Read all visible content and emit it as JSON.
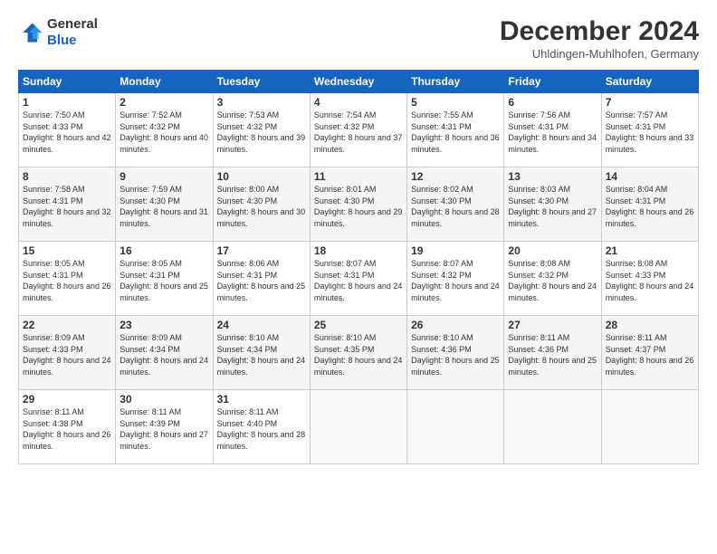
{
  "header": {
    "logo_line1": "General",
    "logo_line2": "Blue",
    "month": "December 2024",
    "location": "Uhldingen-Muhlhofen, Germany"
  },
  "days_of_week": [
    "Sunday",
    "Monday",
    "Tuesday",
    "Wednesday",
    "Thursday",
    "Friday",
    "Saturday"
  ],
  "weeks": [
    [
      {
        "day": "1",
        "rise": "7:50 AM",
        "set": "4:33 PM",
        "daylight": "8 hours and 42 minutes."
      },
      {
        "day": "2",
        "rise": "7:52 AM",
        "set": "4:32 PM",
        "daylight": "8 hours and 40 minutes."
      },
      {
        "day": "3",
        "rise": "7:53 AM",
        "set": "4:32 PM",
        "daylight": "8 hours and 39 minutes."
      },
      {
        "day": "4",
        "rise": "7:54 AM",
        "set": "4:32 PM",
        "daylight": "8 hours and 37 minutes."
      },
      {
        "day": "5",
        "rise": "7:55 AM",
        "set": "4:31 PM",
        "daylight": "8 hours and 36 minutes."
      },
      {
        "day": "6",
        "rise": "7:56 AM",
        "set": "4:31 PM",
        "daylight": "8 hours and 34 minutes."
      },
      {
        "day": "7",
        "rise": "7:57 AM",
        "set": "4:31 PM",
        "daylight": "8 hours and 33 minutes."
      }
    ],
    [
      {
        "day": "8",
        "rise": "7:58 AM",
        "set": "4:31 PM",
        "daylight": "8 hours and 32 minutes."
      },
      {
        "day": "9",
        "rise": "7:59 AM",
        "set": "4:30 PM",
        "daylight": "8 hours and 31 minutes."
      },
      {
        "day": "10",
        "rise": "8:00 AM",
        "set": "4:30 PM",
        "daylight": "8 hours and 30 minutes."
      },
      {
        "day": "11",
        "rise": "8:01 AM",
        "set": "4:30 PM",
        "daylight": "8 hours and 29 minutes."
      },
      {
        "day": "12",
        "rise": "8:02 AM",
        "set": "4:30 PM",
        "daylight": "8 hours and 28 minutes."
      },
      {
        "day": "13",
        "rise": "8:03 AM",
        "set": "4:30 PM",
        "daylight": "8 hours and 27 minutes."
      },
      {
        "day": "14",
        "rise": "8:04 AM",
        "set": "4:31 PM",
        "daylight": "8 hours and 26 minutes."
      }
    ],
    [
      {
        "day": "15",
        "rise": "8:05 AM",
        "set": "4:31 PM",
        "daylight": "8 hours and 26 minutes."
      },
      {
        "day": "16",
        "rise": "8:05 AM",
        "set": "4:31 PM",
        "daylight": "8 hours and 25 minutes."
      },
      {
        "day": "17",
        "rise": "8:06 AM",
        "set": "4:31 PM",
        "daylight": "8 hours and 25 minutes."
      },
      {
        "day": "18",
        "rise": "8:07 AM",
        "set": "4:31 PM",
        "daylight": "8 hours and 24 minutes."
      },
      {
        "day": "19",
        "rise": "8:07 AM",
        "set": "4:32 PM",
        "daylight": "8 hours and 24 minutes."
      },
      {
        "day": "20",
        "rise": "8:08 AM",
        "set": "4:32 PM",
        "daylight": "8 hours and 24 minutes."
      },
      {
        "day": "21",
        "rise": "8:08 AM",
        "set": "4:33 PM",
        "daylight": "8 hours and 24 minutes."
      }
    ],
    [
      {
        "day": "22",
        "rise": "8:09 AM",
        "set": "4:33 PM",
        "daylight": "8 hours and 24 minutes."
      },
      {
        "day": "23",
        "rise": "8:09 AM",
        "set": "4:34 PM",
        "daylight": "8 hours and 24 minutes."
      },
      {
        "day": "24",
        "rise": "8:10 AM",
        "set": "4:34 PM",
        "daylight": "8 hours and 24 minutes."
      },
      {
        "day": "25",
        "rise": "8:10 AM",
        "set": "4:35 PM",
        "daylight": "8 hours and 24 minutes."
      },
      {
        "day": "26",
        "rise": "8:10 AM",
        "set": "4:36 PM",
        "daylight": "8 hours and 25 minutes."
      },
      {
        "day": "27",
        "rise": "8:11 AM",
        "set": "4:36 PM",
        "daylight": "8 hours and 25 minutes."
      },
      {
        "day": "28",
        "rise": "8:11 AM",
        "set": "4:37 PM",
        "daylight": "8 hours and 26 minutes."
      }
    ],
    [
      {
        "day": "29",
        "rise": "8:11 AM",
        "set": "4:38 PM",
        "daylight": "8 hours and 26 minutes."
      },
      {
        "day": "30",
        "rise": "8:11 AM",
        "set": "4:39 PM",
        "daylight": "8 hours and 27 minutes."
      },
      {
        "day": "31",
        "rise": "8:11 AM",
        "set": "4:40 PM",
        "daylight": "8 hours and 28 minutes."
      },
      null,
      null,
      null,
      null
    ]
  ]
}
